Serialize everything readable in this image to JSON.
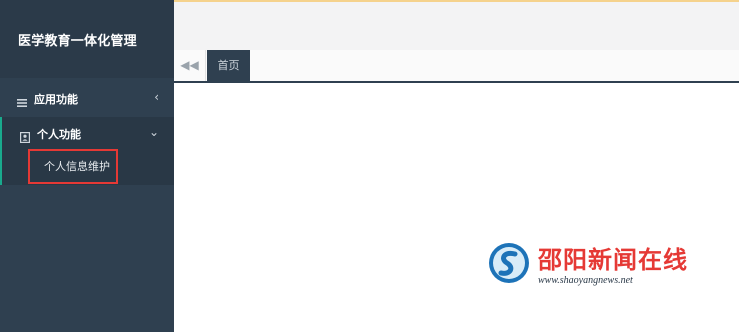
{
  "app": {
    "title": "医学教育一体化管理"
  },
  "sidebar": {
    "menus": [
      {
        "label": "应用功能",
        "icon": "menu-lines-icon",
        "arrow": "chevron-left-icon"
      },
      {
        "label": "个人功能",
        "icon": "user-box-icon",
        "arrow": "chevron-down-icon",
        "expanded": true,
        "submenu": [
          {
            "label": "个人信息维护",
            "highlighted": true
          }
        ]
      }
    ]
  },
  "tabs": {
    "back_icon": "double-left-arrow-icon",
    "items": [
      {
        "label": "首页",
        "active": true
      }
    ]
  },
  "watermark": {
    "title": "邵阳新闻在线",
    "url": "www.shaoyangnews.net"
  },
  "colors": {
    "sidebar": "#2f4050",
    "accent": "#19aa8d",
    "highlight": "#e53935"
  }
}
